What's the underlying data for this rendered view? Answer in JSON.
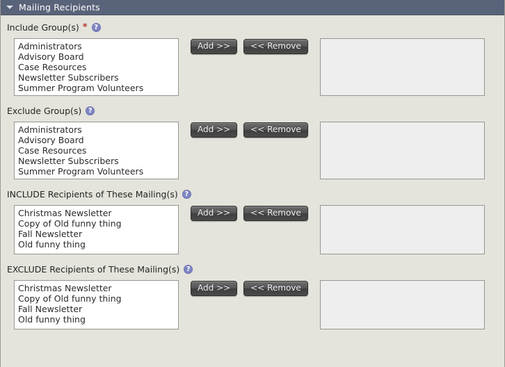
{
  "panel": {
    "title": "Mailing Recipients",
    "collapse_icon": "triangle-down-icon",
    "header_color": "#59637a",
    "background_color": "#e4e4dc"
  },
  "common": {
    "add_label": "Add >>",
    "remove_label": "<< Remove",
    "help_glyph": "?",
    "required_marker": "*"
  },
  "sections": [
    {
      "label": "Include Group(s)",
      "required": true,
      "available": [
        "Administrators",
        "Advisory Board",
        "Case Resources",
        "Newsletter Subscribers",
        "Summer Program Volunteers"
      ],
      "selected": []
    },
    {
      "label": "Exclude Group(s)",
      "required": false,
      "available": [
        "Administrators",
        "Advisory Board",
        "Case Resources",
        "Newsletter Subscribers",
        "Summer Program Volunteers"
      ],
      "selected": []
    },
    {
      "label": "INCLUDE Recipients of These Mailing(s)",
      "required": false,
      "available": [
        "Christmas Newsletter",
        "Copy of Old funny thing",
        "Fall Newsletter",
        "Old funny thing"
      ],
      "selected": []
    },
    {
      "label": "EXCLUDE Recipients of These Mailing(s)",
      "required": false,
      "available": [
        "Christmas Newsletter",
        "Copy of Old funny thing",
        "Fall Newsletter",
        "Old funny thing"
      ],
      "selected": []
    }
  ]
}
